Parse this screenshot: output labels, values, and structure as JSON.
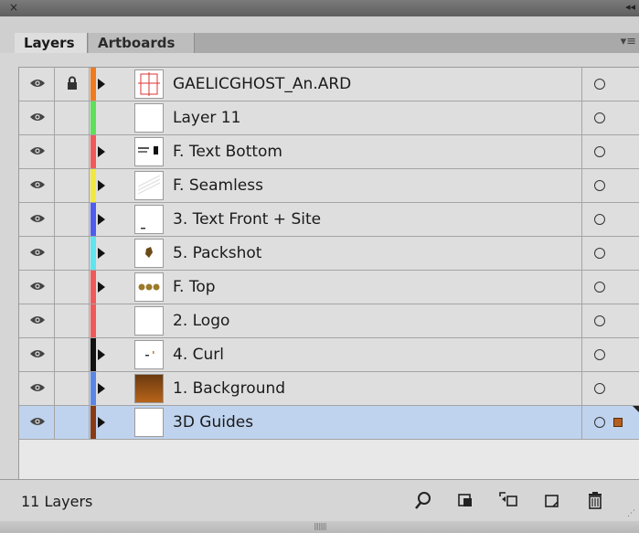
{
  "window": {
    "close_glyph": "×",
    "collapse_glyph": "◂◂"
  },
  "tabs": [
    {
      "label": "Layers",
      "active": true
    },
    {
      "label": "Artboards",
      "active": false
    }
  ],
  "panel_menu_glyph": "▾≡",
  "layers": [
    {
      "name": "GAELICGHOST_An.ARD",
      "color": "#f07a1e",
      "locked": true,
      "expandable": true,
      "thumb": "artboard-thumb",
      "selected": false
    },
    {
      "name": "Layer 11",
      "color": "#5de05a",
      "locked": false,
      "expandable": false,
      "thumb": "blank-thumb",
      "selected": false
    },
    {
      "name": "F. Text Bottom",
      "color": "#f25858",
      "locked": false,
      "expandable": true,
      "thumb": "text-thumb",
      "selected": false
    },
    {
      "name": "F. Seamless",
      "color": "#f3e93c",
      "locked": false,
      "expandable": true,
      "thumb": "pattern-thumb",
      "selected": false
    },
    {
      "name": "3. Text Front + Site",
      "color": "#4f5cf0",
      "locked": false,
      "expandable": true,
      "thumb": "text-front-thumb",
      "selected": false
    },
    {
      "name": "5. Packshot",
      "color": "#5ee6f0",
      "locked": false,
      "expandable": true,
      "thumb": "packshot-thumb",
      "selected": false
    },
    {
      "name": "F. Top",
      "color": "#f25858",
      "locked": false,
      "expandable": true,
      "thumb": "top-thumb",
      "selected": false
    },
    {
      "name": "2. Logo",
      "color": "#f25858",
      "locked": false,
      "expandable": false,
      "thumb": "blank-thumb",
      "selected": false
    },
    {
      "name": "4. Curl",
      "color": "#111111",
      "locked": false,
      "expandable": true,
      "thumb": "curl-thumb",
      "selected": false
    },
    {
      "name": "1. Background",
      "color": "#5a86e8",
      "locked": false,
      "expandable": true,
      "thumb": "background-thumb",
      "selected": false
    },
    {
      "name": "3D Guides",
      "color": "#8a3a12",
      "locked": false,
      "expandable": true,
      "thumb": "blank-thumb",
      "selected": true
    }
  ],
  "footer": {
    "count_label": "11 Layers",
    "icons": [
      "locate-object-icon",
      "make-clipping-mask-icon",
      "create-sublayer-icon",
      "create-new-layer-icon",
      "delete-layer-icon"
    ]
  },
  "colors": {
    "selection": "#bfd3ee",
    "selection_square": "#b45f20"
  }
}
